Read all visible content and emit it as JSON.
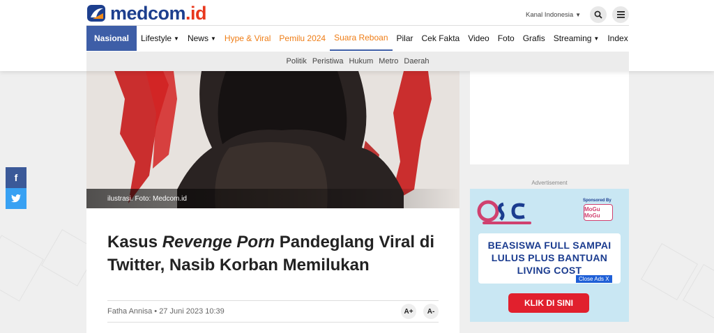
{
  "brand": {
    "name": "medcom",
    "tld": ".id"
  },
  "header": {
    "kanal_label": "Kanal Indonesia",
    "nav": [
      {
        "label": "Nasional",
        "caret": false
      },
      {
        "label": "Lifestyle",
        "caret": true
      },
      {
        "label": "News",
        "caret": true
      },
      {
        "label": "Hype & Viral",
        "caret": false
      },
      {
        "label": "Pemilu 2024",
        "caret": false
      },
      {
        "label": "Suara Reboan",
        "caret": false
      },
      {
        "label": "Pilar",
        "caret": false
      },
      {
        "label": "Cek Fakta",
        "caret": false
      },
      {
        "label": "Video",
        "caret": false
      },
      {
        "label": "Foto",
        "caret": false
      },
      {
        "label": "Grafis",
        "caret": false
      },
      {
        "label": "Streaming",
        "caret": true
      },
      {
        "label": "Index",
        "caret": false
      }
    ],
    "subnav": [
      "Politik",
      "Peristiwa",
      "Hukum",
      "Metro",
      "Daerah"
    ]
  },
  "social": {
    "facebook": "f",
    "twitter": "t"
  },
  "hero": {
    "caption": "ilustrasi. Foto: Medcom.id"
  },
  "article": {
    "title_pre": "Kasus ",
    "title_em": "Revenge Porn",
    "title_post": " Pandeglang Viral di Twitter, Nasib Korban Memilukan",
    "author": "Fatha Annisa",
    "date": "27 Juni 2023 10:39",
    "font_plus": "A+",
    "font_minus": "A-"
  },
  "sidebar": {
    "ad_label": "Advertisement",
    "ad": {
      "sponsor_label": "Sponsored By",
      "sponsor_name": "MoGu MoGu",
      "headline_lines": [
        "BEASISWA FULL SAMPAI",
        "LULUS PLUS BANTUAN",
        "LIVING COST"
      ],
      "close_label": "Close Ads X",
      "cta": "KLIK DI SINI"
    }
  },
  "colors": {
    "brand_blue": "#1d3f8e",
    "nav_active": "#3e5ea7",
    "nav_orange": "#ef7d16",
    "ad_red": "#e1202d"
  }
}
